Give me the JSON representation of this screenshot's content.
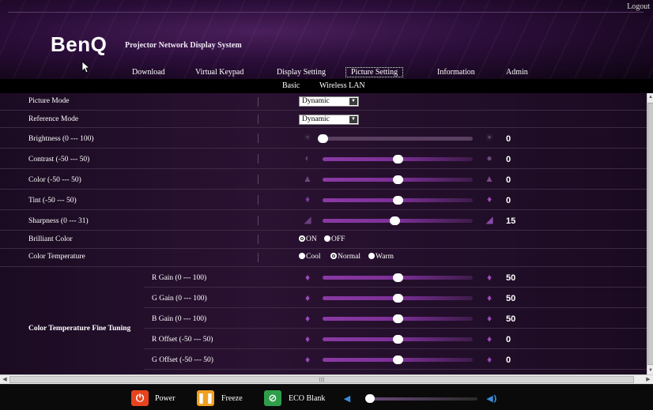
{
  "header": {
    "logout": "Logout",
    "logo": "BenQ",
    "product": "Projector Network Display System"
  },
  "nav": {
    "items": [
      "Download",
      "Virtual Keypad",
      "Display Setting",
      "Picture Setting",
      "Information",
      "Admin"
    ],
    "active": "Picture Setting",
    "sub": [
      "Basic",
      "Wireless LAN"
    ]
  },
  "picture": {
    "picture_mode": {
      "label": "Picture Mode",
      "value": "Dynamic"
    },
    "reference_mode": {
      "label": "Reference Mode",
      "value": "Dynamic"
    },
    "brightness": {
      "label": "Brightness (0 --- 100)",
      "value": "0",
      "level": 0.0
    },
    "contrast": {
      "label": "Contrast (-50 --- 50)",
      "value": "0",
      "level": 0.5
    },
    "color": {
      "label": "Color (-50 --- 50)",
      "value": "0",
      "level": 0.5
    },
    "tint": {
      "label": "Tint (-50 --- 50)",
      "value": "0",
      "level": 0.5
    },
    "sharpness": {
      "label": "Sharpness (0 --- 31)",
      "value": "15",
      "level": 0.48
    },
    "brilliant_color": {
      "label": "Brilliant Color",
      "on": "ON",
      "off": "OFF",
      "selected": "ON"
    },
    "color_temperature": {
      "label": "Color Temperature",
      "options": [
        "Cool",
        "Normal",
        "Warm"
      ],
      "selected": "Normal"
    },
    "fine_tuning": {
      "label": "Color Temperature Fine Tuning",
      "items": [
        {
          "label": "R Gain (0 --- 100)",
          "value": "50",
          "level": 0.5
        },
        {
          "label": "G Gain (0 --- 100)",
          "value": "50",
          "level": 0.5
        },
        {
          "label": "B Gain (0 --- 100)",
          "value": "50",
          "level": 0.5
        },
        {
          "label": "R Offset (-50 --- 50)",
          "value": "0",
          "level": 0.5
        },
        {
          "label": "G Offset (-50 --- 50)",
          "value": "0",
          "level": 0.5
        }
      ]
    }
  },
  "scrollbar": {
    "grip": "III"
  },
  "footer": {
    "power": "Power",
    "freeze": "Freeze",
    "eco_blank": "ECO Blank",
    "volume_level": 0.0
  },
  "colors": {
    "power": "#e8431e",
    "freeze": "#f0a020",
    "eco": "#2e9e4a",
    "accent": "#8a3aa4"
  }
}
